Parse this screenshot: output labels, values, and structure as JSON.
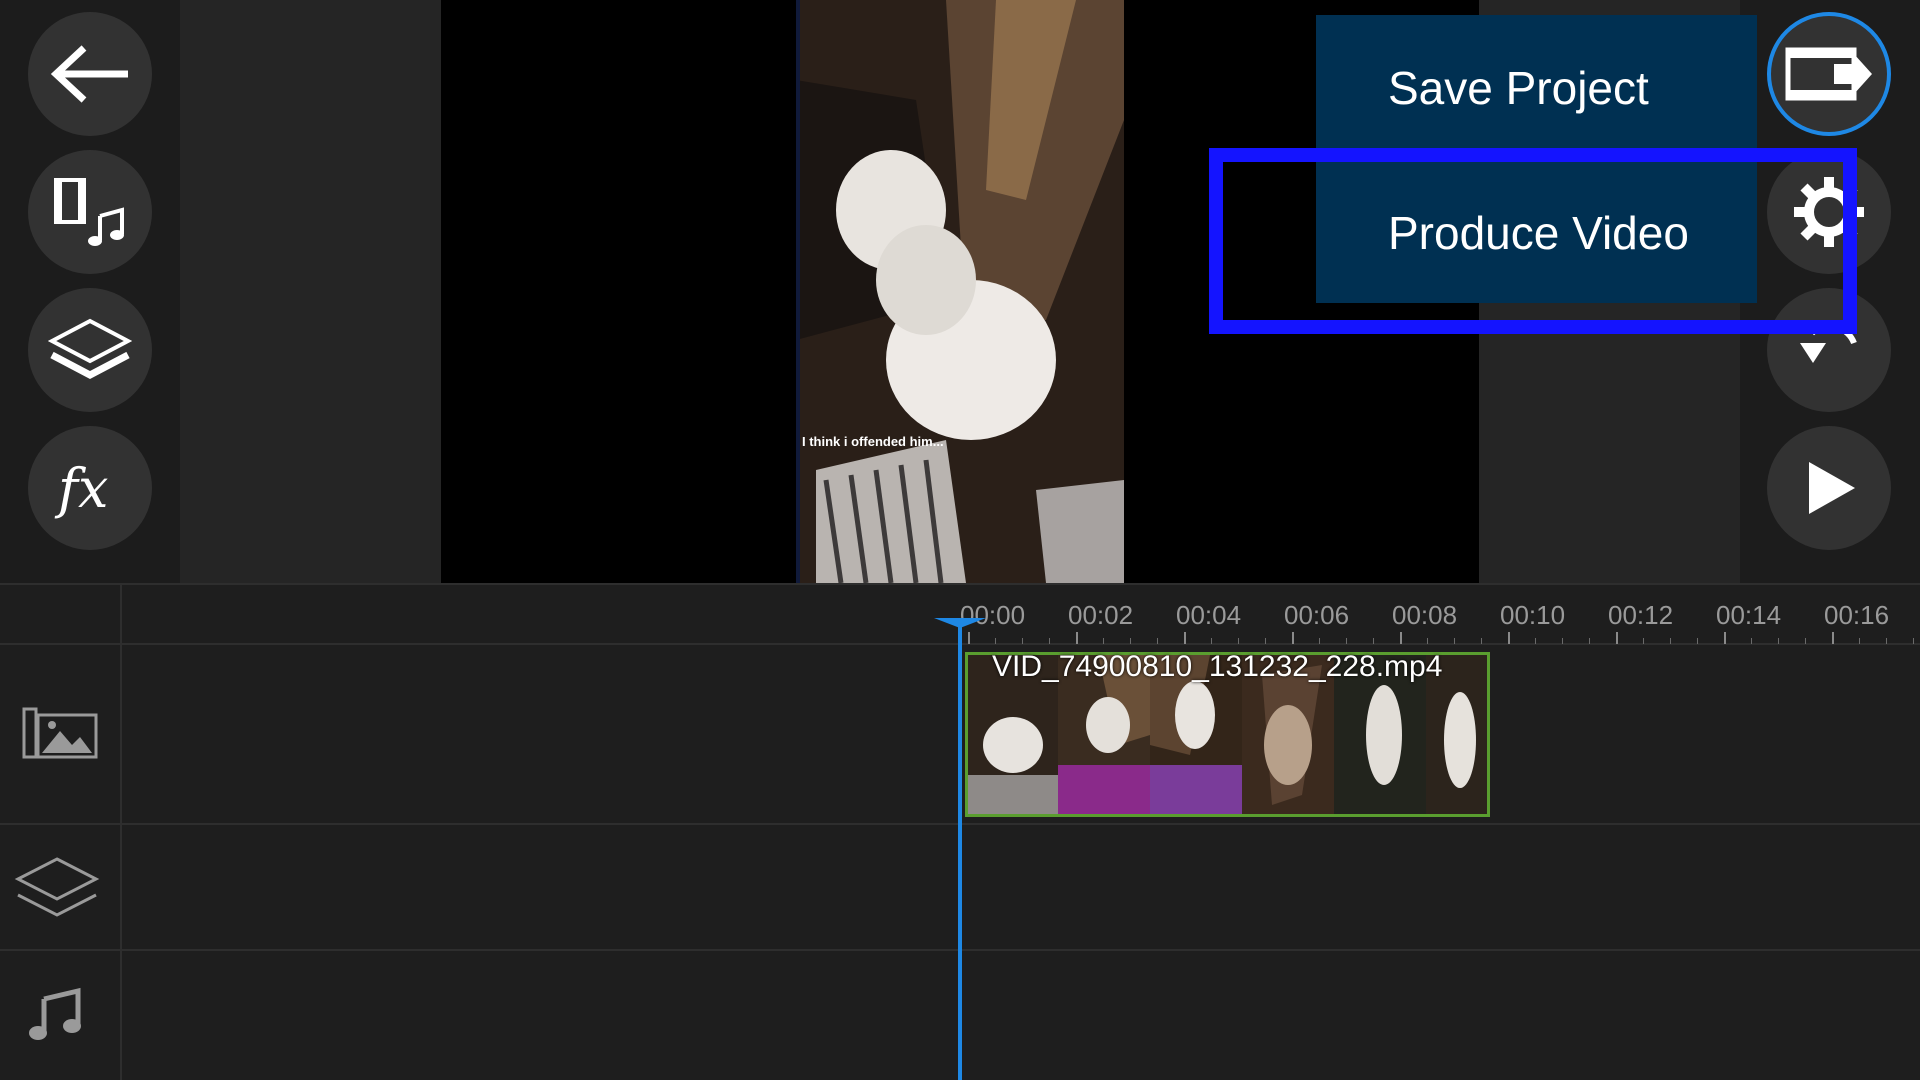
{
  "menu": {
    "save_project": "Save Project",
    "produce_video": "Produce Video"
  },
  "preview": {
    "caption": "I think i offended him..."
  },
  "timeline": {
    "ticks": [
      "00:00",
      "00:02",
      "00:04",
      "00:06",
      "00:08",
      "00:10",
      "00:12",
      "00:14",
      "00:16"
    ],
    "clip_name": "VID_74900810_131232_228.mp4"
  },
  "icons": {
    "left": [
      "back-arrow-icon",
      "media-music-icon",
      "layers-icon",
      "fx-icon"
    ],
    "right": [
      "export-film-icon",
      "gear-icon",
      "rotate-icon",
      "play-icon"
    ],
    "tracks": [
      "image-track-icon",
      "layers-track-icon",
      "music-track-icon"
    ]
  },
  "colors": {
    "menu_bg": "#003052",
    "highlight": "#1414ff",
    "playhead": "#1e88e5",
    "clip_border": "#5a9e2f"
  }
}
